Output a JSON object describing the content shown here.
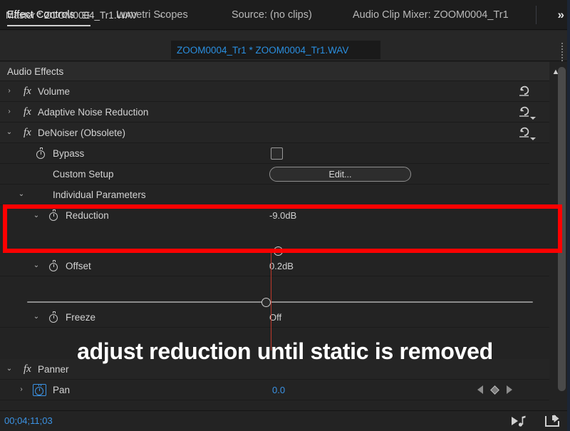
{
  "window": {
    "app": "Adobe Premiere Pro - Effect Controls"
  },
  "tabbar": {
    "tabs": [
      {
        "label": "Effect Controls",
        "active": true,
        "menu_icon": "hamburger-menu-icon"
      },
      {
        "label": "Lumetri Scopes",
        "active": false
      },
      {
        "label": "Source: (no clips)",
        "active": false
      },
      {
        "label": "Audio Clip Mixer: ZOOM0004_Tr1",
        "active": false
      }
    ],
    "overflow_label": "»"
  },
  "clipbar": {
    "master_label": "Master * ZOOM0004_Tr1.WAV",
    "chevron": "⌄",
    "selected_clip": "ZOOM0004_Tr1 * ZOOM0004_Tr1.WAV",
    "grip_name": "panel-grip"
  },
  "section": {
    "title": "Audio Effects",
    "collapse_glyph": "▲"
  },
  "effects": [
    {
      "name": "Volume",
      "twisty": "›",
      "fx": "fx",
      "expanded": false,
      "reset": {
        "icon": "reset-icon",
        "has_caret": false
      }
    },
    {
      "name": "Adaptive Noise Reduction",
      "twisty": "›",
      "fx": "fx",
      "expanded": false,
      "reset": {
        "icon": "reset-icon",
        "has_caret": true
      }
    },
    {
      "name": "DeNoiser (Obsolete)",
      "twisty": "⌄",
      "fx": "fx",
      "expanded": true,
      "reset": {
        "icon": "reset-icon",
        "has_caret": true
      }
    }
  ],
  "denoiser_params": {
    "bypass": {
      "label": "Bypass",
      "stopwatch": "stopwatch-icon",
      "checked": false
    },
    "custom_setup": {
      "label": "Custom Setup",
      "button_label": "Edit..."
    },
    "individual_parameters": {
      "label": "Individual Parameters",
      "twisty": "⌄"
    },
    "reduction": {
      "label": "Reduction",
      "twisty": "⌄",
      "stopwatch": "stopwatch-icon",
      "value": "-9.0dB",
      "slider_percent": 49.6
    },
    "offset": {
      "label": "Offset",
      "twisty": "⌄",
      "stopwatch": "stopwatch-icon",
      "value": "0.2dB",
      "slider_percent": 47.2
    },
    "freeze": {
      "label": "Freeze",
      "twisty": "⌄",
      "stopwatch": "stopwatch-icon",
      "value": "Off"
    }
  },
  "panner": {
    "name": "Panner",
    "twisty": "⌄",
    "fx": "fx",
    "pan": {
      "label": "Pan",
      "twisty": "›",
      "stopwatch": "stopwatch-icon",
      "stopwatch_enabled": true,
      "value": "0.0",
      "keyframe_prev": "keyframe-prev-icon",
      "keyframe_marker": "keyframe-diamond-icon",
      "keyframe_next": "keyframe-next-icon"
    }
  },
  "annotation": {
    "caption": "adjust reduction until static is removed",
    "highlight_color": "#ff0000",
    "playhead_color": "#c0392b"
  },
  "statusbar": {
    "timecode": "00;04;11;03",
    "play_audio_icon": "play-audio-icon",
    "export_frame_icon": "export-frame-icon"
  },
  "colors": {
    "accent_blue": "#3b93e5",
    "panel_bg": "#232323",
    "row_bg": "#252525"
  }
}
